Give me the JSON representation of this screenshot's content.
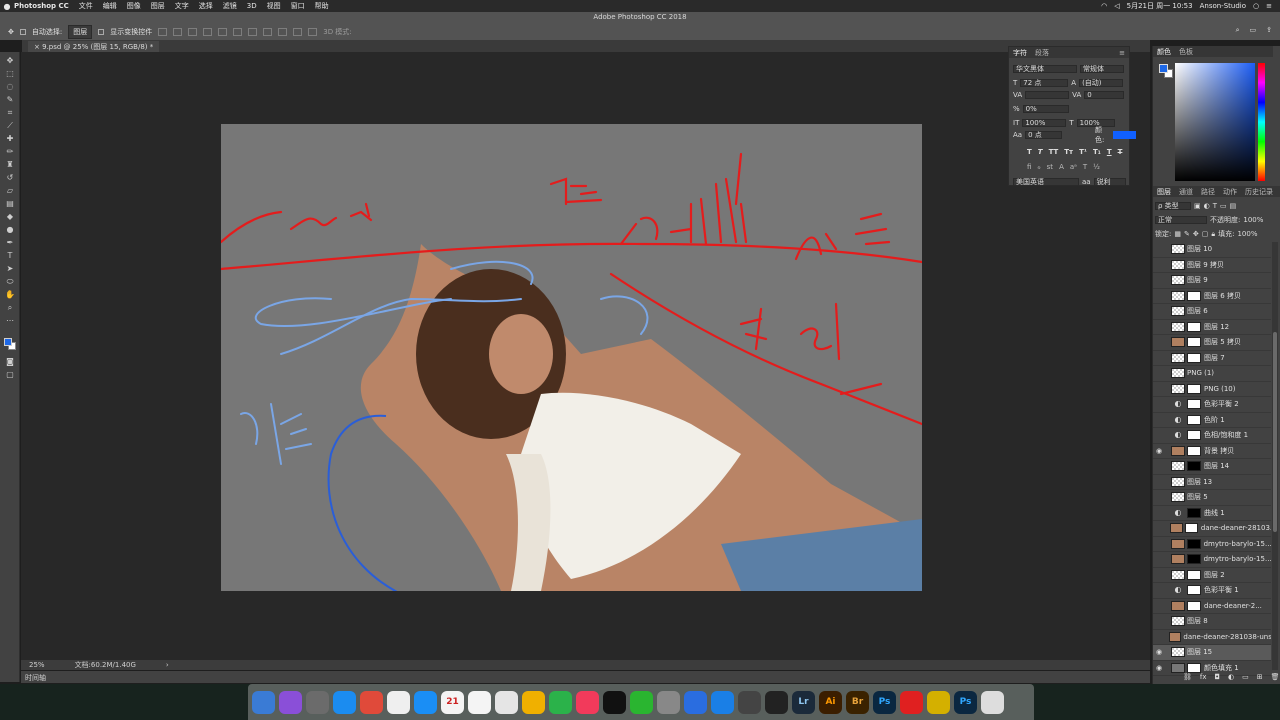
{
  "menubar": {
    "apple": "",
    "app_name": "Photoshop CC",
    "menus": [
      "文件",
      "编辑",
      "图像",
      "图层",
      "文字",
      "选择",
      "滤镜",
      "3D",
      "视图",
      "窗口",
      "帮助"
    ],
    "window_title": "Adobe Photoshop CC 2018",
    "date_time": "5月21日 周一  10:53",
    "user": "Anson-Studio"
  },
  "options": {
    "auto_select_label": "自动选择:",
    "auto_select_value": "图层",
    "show_transform_label": "显示变换控件",
    "mode_3d": "3D 模式:"
  },
  "document": {
    "tab_title": "9.psd @ 25% (图层 15, RGB/8) *"
  },
  "status": {
    "zoom": "25%",
    "doc_size": "文档:60.2M/1.40G",
    "timeline": "时间轴"
  },
  "character": {
    "tabs": [
      "字符",
      "段落"
    ],
    "font_family": "华文黑体",
    "font_style": "常规体",
    "font_size": "72 点",
    "leading": "(自动)",
    "kerning": "",
    "tracking": "0",
    "scale_label": "0%",
    "vscale": "100%",
    "hscale": "100%",
    "baseline": "0 点",
    "color_label": "颜色:",
    "language": "美国英语",
    "antialias": "锐利",
    "color": "#1060ff"
  },
  "color_panel": {
    "tabs": [
      "颜色",
      "色板"
    ]
  },
  "layers_panel": {
    "tabs": [
      "图层",
      "通道",
      "路径",
      "动作",
      "历史记录"
    ],
    "kind_filter": "ρ 类型",
    "blend_mode": "正常",
    "opacity_label": "不透明度:",
    "opacity": "100%",
    "lock_label": "锁定:",
    "fill_label": "填充:",
    "fill": "100%",
    "layers": [
      {
        "name": "图层 10",
        "visible": false,
        "mask": "none",
        "thumb": "transparent"
      },
      {
        "name": "图层 9 拷贝",
        "visible": false,
        "mask": "none",
        "thumb": "transparent"
      },
      {
        "name": "图层 9",
        "visible": false,
        "mask": "none",
        "thumb": "transparent"
      },
      {
        "name": "图层 6 拷贝",
        "visible": false,
        "mask": "white",
        "thumb": "transparent"
      },
      {
        "name": "图层 6",
        "visible": false,
        "mask": "none",
        "thumb": "transparent"
      },
      {
        "name": "图层 12",
        "visible": false,
        "mask": "white",
        "thumb": "transparent"
      },
      {
        "name": "图层 5 拷贝",
        "visible": false,
        "mask": "white",
        "thumb": "photo"
      },
      {
        "name": "图层 7",
        "visible": false,
        "mask": "white",
        "thumb": "transparent"
      },
      {
        "name": "PNG (1)",
        "visible": false,
        "mask": "none",
        "thumb": "transparent"
      },
      {
        "name": "PNG (10)",
        "visible": false,
        "mask": "white",
        "thumb": "transparent"
      },
      {
        "name": "色彩平衡 2",
        "visible": false,
        "mask": "white",
        "thumb": "adjust"
      },
      {
        "name": "色阶 1",
        "visible": false,
        "mask": "white",
        "thumb": "adjust"
      },
      {
        "name": "色相/饱和度 1",
        "visible": false,
        "mask": "white",
        "thumb": "adjust"
      },
      {
        "name": "背景 拷贝",
        "visible": true,
        "mask": "white",
        "thumb": "photo"
      },
      {
        "name": "图层 14",
        "visible": false,
        "mask": "black",
        "thumb": "transparent"
      },
      {
        "name": "图层 13",
        "visible": false,
        "mask": "none",
        "thumb": "transparent"
      },
      {
        "name": "图层 5",
        "visible": false,
        "mask": "none",
        "thumb": "transparent"
      },
      {
        "name": "曲线 1",
        "visible": false,
        "mask": "black",
        "thumb": "adjust"
      },
      {
        "name": "dane-deaner-28103...",
        "visible": false,
        "mask": "white",
        "thumb": "photo"
      },
      {
        "name": "dmytro-barylo-15...",
        "visible": false,
        "mask": "black",
        "thumb": "photo"
      },
      {
        "name": "dmytro-barylo-15...",
        "visible": false,
        "mask": "black",
        "thumb": "photo"
      },
      {
        "name": "图层 2",
        "visible": false,
        "mask": "white",
        "thumb": "transparent"
      },
      {
        "name": "色彩平衡 1",
        "visible": false,
        "mask": "white",
        "thumb": "adjust"
      },
      {
        "name": "dane-deaner-2...",
        "visible": false,
        "mask": "white",
        "thumb": "photo"
      },
      {
        "name": "图层 8",
        "visible": false,
        "mask": "none",
        "thumb": "transparent"
      },
      {
        "name": "dane-deaner-281038-unsp...",
        "visible": false,
        "mask": "none",
        "thumb": "photo"
      },
      {
        "name": "图层 15",
        "visible": true,
        "mask": "none",
        "thumb": "transparent",
        "selected": true
      },
      {
        "name": "颜色填充 1",
        "visible": true,
        "mask": "white",
        "thumb": "fill"
      }
    ]
  },
  "dock": {
    "apps": [
      {
        "label": "",
        "color": "#3a7bd5"
      },
      {
        "label": "",
        "color": "#8a4fd8"
      },
      {
        "label": "",
        "color": "#6b6b6b"
      },
      {
        "label": "",
        "color": "#1b8cf0"
      },
      {
        "label": "",
        "color": "#e04a3a"
      },
      {
        "label": "",
        "color": "#efefef"
      },
      {
        "label": "",
        "color": "#1a8ef5"
      },
      {
        "label": "21",
        "color": "#f4f4f4"
      },
      {
        "label": "",
        "color": "#f4f4f4"
      },
      {
        "label": "",
        "color": "#e5e5e5"
      },
      {
        "label": "",
        "color": "#f0b000"
      },
      {
        "label": "",
        "color": "#2bb24a"
      },
      {
        "label": "",
        "color": "#f23a5b"
      },
      {
        "label": "",
        "color": "#111111"
      },
      {
        "label": "",
        "color": "#2ab530"
      },
      {
        "label": "",
        "color": "#888888"
      },
      {
        "label": "",
        "color": "#2a6de0"
      },
      {
        "label": "",
        "color": "#1a7fe6"
      },
      {
        "label": "",
        "color": "#444444"
      },
      {
        "label": "",
        "color": "#222222"
      },
      {
        "label": "Lr",
        "color": "#1b2a3a"
      },
      {
        "label": "Ai",
        "color": "#3b1e00"
      },
      {
        "label": "Br",
        "color": "#3a2200"
      },
      {
        "label": "Ps",
        "color": "#0a2740"
      },
      {
        "label": "",
        "color": "#e02020"
      },
      {
        "label": "",
        "color": "#d4b000"
      },
      {
        "label": "Ps",
        "color": "#0a2740"
      },
      {
        "label": "",
        "color": "#dddddd"
      }
    ]
  }
}
